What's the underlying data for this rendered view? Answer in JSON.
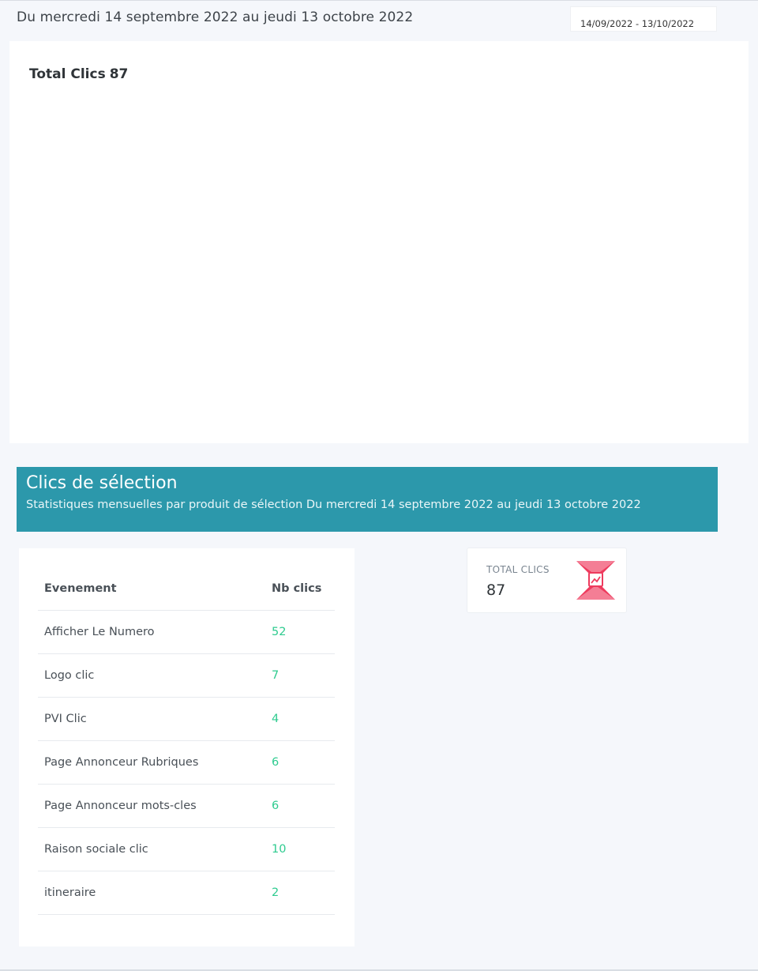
{
  "header": {
    "date_range_text": "Du mercredi 14 septembre 2022 au jeudi 13 octobre 2022",
    "date_picker_value": "14/09/2022 - 13/10/2022"
  },
  "chart": {
    "title_label": "Total Clics",
    "title_value": "87"
  },
  "chart_data": {
    "type": "line",
    "title": "Total Clics 87",
    "series": []
  },
  "selection": {
    "title": "Clics de sélection",
    "subtitle": "Statistiques mensuelles par produit de sélection Du mercredi 14 septembre 2022 au jeudi 13 octobre 2022"
  },
  "table": {
    "headers": [
      "Evenement",
      "Nb clics"
    ],
    "rows": [
      {
        "event": "Afficher Le Numero",
        "clicks": "52"
      },
      {
        "event": "Logo clic",
        "clicks": "7"
      },
      {
        "event": "PVI Clic",
        "clicks": "4"
      },
      {
        "event": "Page Annonceur Rubriques",
        "clicks": "6"
      },
      {
        "event": "Page Annonceur mots-cles",
        "clicks": "6"
      },
      {
        "event": "Raison sociale clic",
        "clicks": "10"
      },
      {
        "event": "itineraire",
        "clicks": "2"
      }
    ]
  },
  "total": {
    "label": "TOTAL CLICS",
    "value": "87",
    "icon": "chart-icon"
  },
  "colors": {
    "banner": "#2c98ab",
    "value_green": "#2ecb8f",
    "icon_red": "#ee3a5d"
  }
}
